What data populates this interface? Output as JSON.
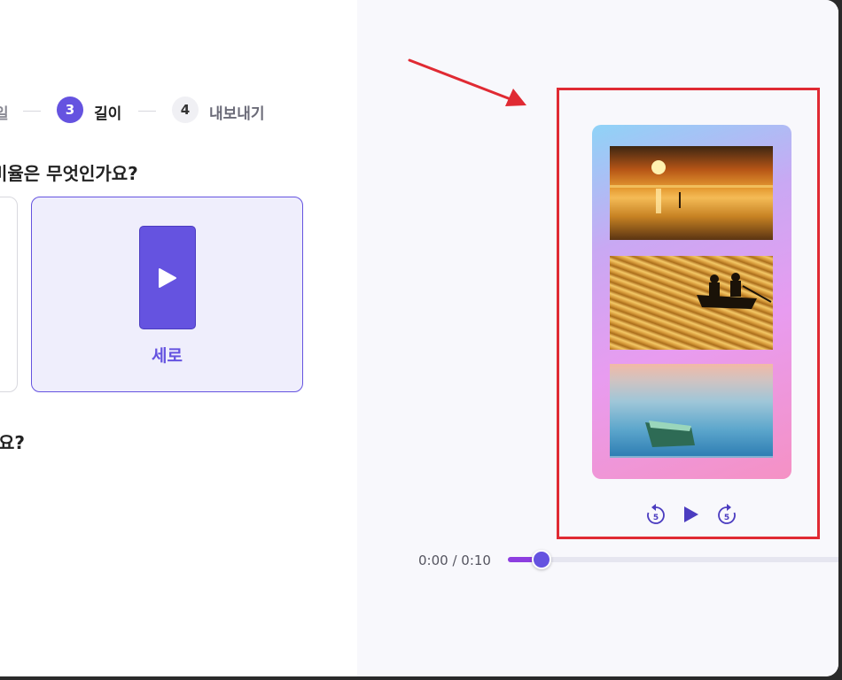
{
  "stepper": {
    "prev_label": "일",
    "steps": [
      {
        "number": "3",
        "label": "길이",
        "state": "active"
      },
      {
        "number": "4",
        "label": "내보내기",
        "state": "inactive"
      }
    ]
  },
  "questions": {
    "aspect": "비율은 무엇인가요?",
    "second": "요?"
  },
  "aspect_options": {
    "selected_label": "세로"
  },
  "preview": {
    "time": "0:00 / 0:10",
    "progress": 0.1,
    "controls": {
      "rewind_seconds": "5",
      "forward_seconds": "5"
    }
  },
  "colors": {
    "accent": "#6553e0",
    "highlight": "#e02a33",
    "progress_fill": "#8d3ee0"
  },
  "icons": [
    "play-icon",
    "rewind-5-icon",
    "forward-5-icon",
    "arrow-annotation"
  ]
}
